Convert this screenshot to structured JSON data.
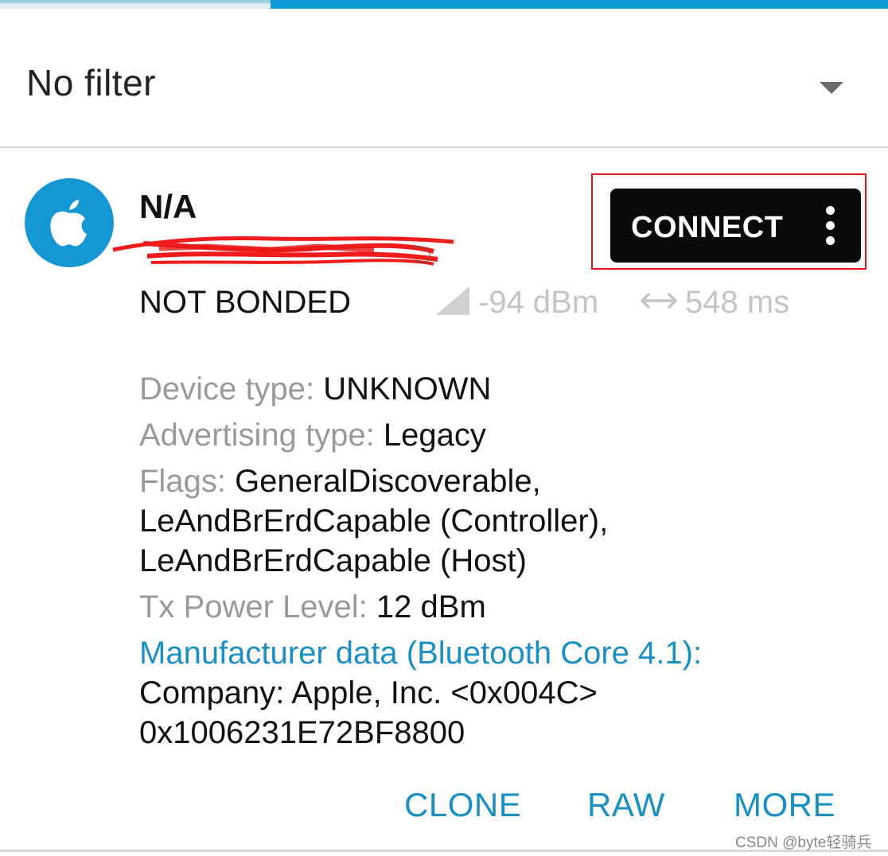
{
  "theme": {
    "accent": "#0f9bd6",
    "link": "#1a8fc4",
    "button_bg": "#0a0a0a",
    "highlight": "#e5141b"
  },
  "filter": {
    "label": "No filter",
    "icon": "dropdown-caret-icon"
  },
  "device": {
    "avatar_icon": "apple-logo-icon",
    "name": "N/A",
    "bond_state": "NOT BONDED",
    "rssi": "-94 dBm",
    "interval": "548 ms",
    "signal_icon": "signal-strength-icon",
    "interval_icon": "left-right-arrow-icon"
  },
  "connect": {
    "label": "CONNECT",
    "menu_icon": "more-vert-icon"
  },
  "details": {
    "device_type_label": "Device type:",
    "device_type_value": "UNKNOWN",
    "advertising_type_label": "Advertising type:",
    "advertising_type_value": "Legacy",
    "flags_label": "Flags:",
    "flags_value_1": "GeneralDiscoverable,",
    "flags_value_2": "LeAndBrErdCapable (Controller),",
    "flags_value_3": "LeAndBrErdCapable (Host)",
    "tx_power_label": "Tx Power Level:",
    "tx_power_value": "12 dBm",
    "manufacturer_title": "Manufacturer data (Bluetooth Core 4.1):",
    "company": "Company: Apple, Inc. <0x004C>",
    "payload": "0x1006231E72BF8800"
  },
  "actions": {
    "clone": "CLONE",
    "raw": "RAW",
    "more": "MORE"
  },
  "watermark": "CSDN @byte轻骑兵"
}
